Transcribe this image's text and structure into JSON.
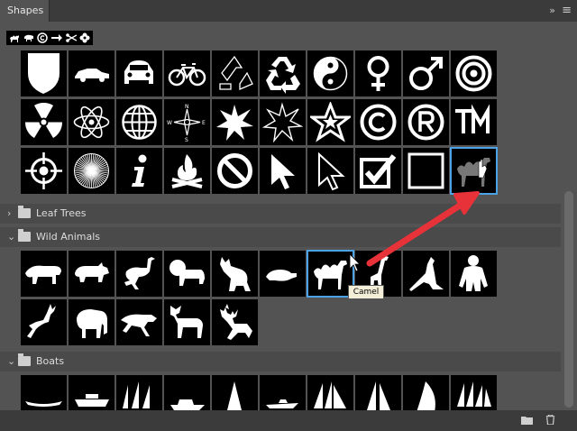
{
  "panel": {
    "title": "Shapes",
    "collapse_glyph": "»",
    "menu_glyph": "≡"
  },
  "toolbar": {
    "recent_icons": [
      "camel-icon",
      "buffalo-icon",
      "copyright-icon",
      "arrow-icon",
      "scissors-icon",
      "flower-icon"
    ]
  },
  "grid_row1": [
    "shield",
    "car-side",
    "car-front",
    "bicycle",
    "recycle-outline",
    "recycle",
    "yin-yang",
    "female-symbol",
    "male-symbol",
    "target"
  ],
  "grid_row2": [
    "radiation",
    "atom",
    "globe",
    "compass",
    "starburst",
    "starburst-outline",
    "star-outline",
    "copyright",
    "registered",
    "trademark"
  ],
  "grid_row3": [
    "crosshair",
    "sunburst",
    "info",
    "campfire",
    "no-sign",
    "cursor",
    "cursor-outline",
    "checkbox-checked",
    "square",
    "camel"
  ],
  "groups": {
    "leaf_trees": {
      "label": "Leaf Trees",
      "state": "collapsed"
    },
    "wild_animals": {
      "label": "Wild Animals",
      "state": "expanded"
    },
    "boats": {
      "label": "Boats",
      "state": "expanded"
    }
  },
  "wild_animals_row1": [
    "tiger",
    "rhino",
    "ostrich",
    "lion",
    "wolf",
    "rat",
    "camel",
    "giraffe",
    "kangaroo",
    "ape"
  ],
  "wild_animals_row2": [
    "deer",
    "elephant",
    "cheetah",
    "moose",
    "reindeer"
  ],
  "tooltip": {
    "text": "Camel"
  },
  "bottom": {
    "new_group_icon": "folder-icon",
    "delete_icon": "trash-icon"
  },
  "colors": {
    "accent_selection": "#4ba3e6",
    "annotation_arrow": "#e8323a"
  }
}
